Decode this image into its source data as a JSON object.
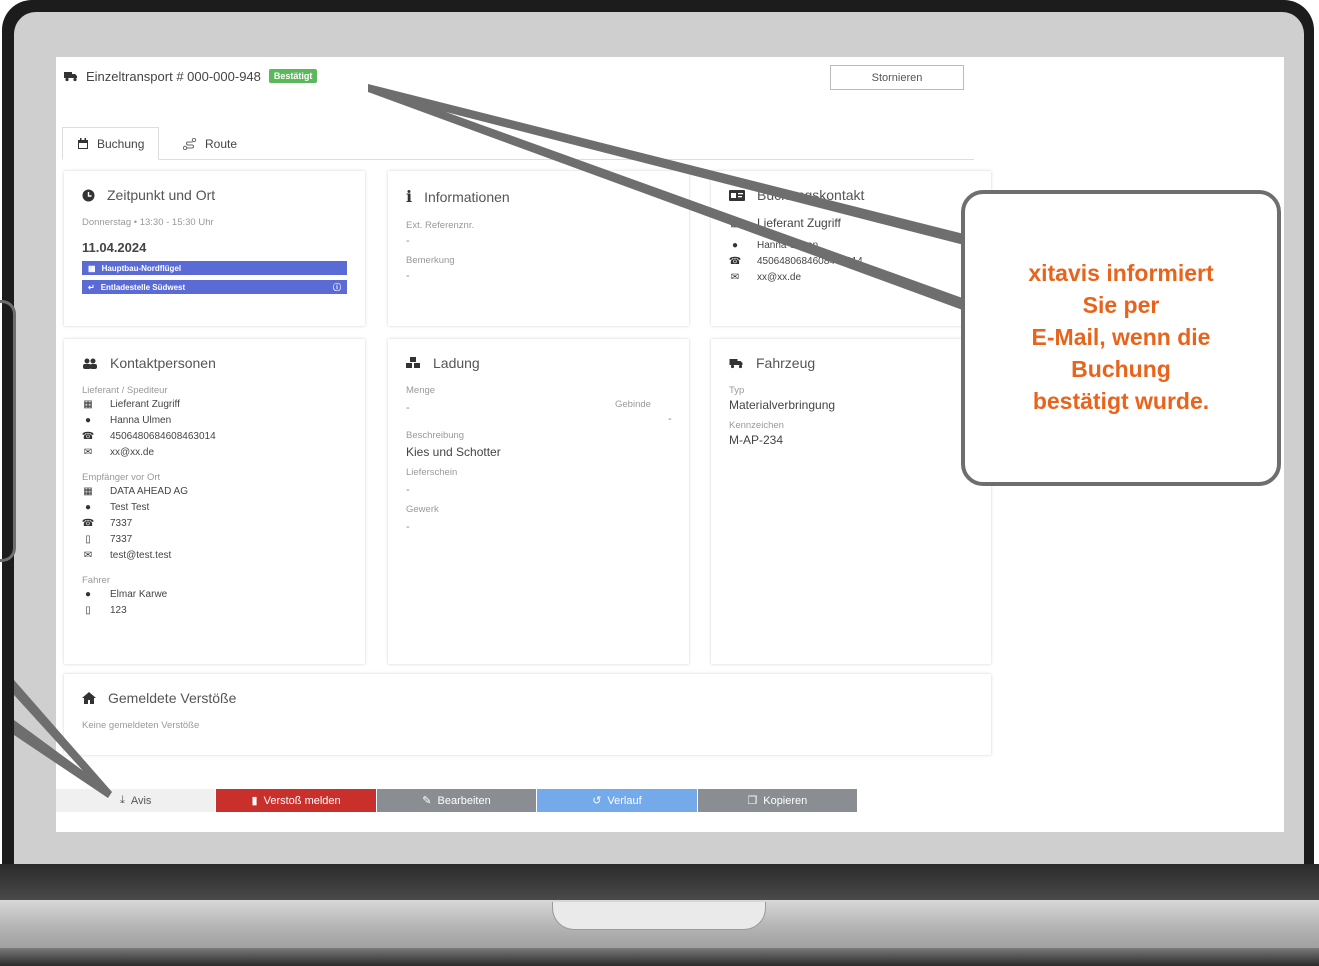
{
  "header": {
    "title": "Einzeltransport # 000-000-948",
    "status_badge": "Bestätigt",
    "cancel_label": "Stornieren"
  },
  "tabs": [
    {
      "label": "Buchung",
      "active": true
    },
    {
      "label": "Route",
      "active": false
    }
  ],
  "zeitpunkt": {
    "title": "Zeitpunkt und Ort",
    "time_text": "Donnerstag • 13:30 - 15:30 Uhr",
    "date": "11.04.2024",
    "locations": [
      "Hauptbau-Nordflügel",
      "Entladestelle Südwest"
    ]
  },
  "informationen": {
    "title": "Informationen",
    "ref_label": "Ext. Referenznr.",
    "ref_value": "-",
    "note_label": "Bemerkung",
    "note_value": "-"
  },
  "buchungskontakt": {
    "title": "Buchungskontakt",
    "company": "Lieferant Zugriff",
    "person": "Hanna Ulmen",
    "phone": "4506480684608463014",
    "email": "xx@xx.de"
  },
  "kontaktpersonen": {
    "title": "Kontaktpersonen",
    "lieferant_label": "Lieferant / Spediteur",
    "lieferant": {
      "company": "Lieferant Zugriff",
      "person": "Hanna Ulmen",
      "phone": "4506480684608463014",
      "email": "xx@xx.de"
    },
    "empfaenger_label": "Empfänger vor Ort",
    "empfaenger": {
      "company": "DATA AHEAD AG",
      "person": "Test Test",
      "phone": "7337",
      "mobile": "7337",
      "email": "test@test.test"
    },
    "fahrer_label": "Fahrer",
    "fahrer": {
      "person": "Elmar Karwe",
      "mobile": "123"
    }
  },
  "ladung": {
    "title": "Ladung",
    "menge_label": "Menge",
    "menge_value": "-",
    "gebinde_label": "Gebinde",
    "gebinde_value": "-",
    "beschreibung_label": "Beschreibung",
    "beschreibung_value": "Kies und Schotter",
    "lieferschein_label": "Lieferschein",
    "lieferschein_value": "-",
    "gewerk_label": "Gewerk",
    "gewerk_value": "-"
  },
  "fahrzeug": {
    "title": "Fahrzeug",
    "typ_label": "Typ",
    "typ_value": "Materialverbringung",
    "kennzeichen_label": "Kennzeichen",
    "kennzeichen_value": "M-AP-234"
  },
  "verstoesse": {
    "title": "Gemeldete Verstöße",
    "empty_text": "Keine gemeldeten Verstöße"
  },
  "actions": [
    {
      "label": "Avis",
      "icon": "download-icon",
      "color": "#f0f0f0",
      "text_color": "#555555"
    },
    {
      "label": "Verstoß melden",
      "icon": "file-icon",
      "color": "#c9302c",
      "text_color": "#ffffff"
    },
    {
      "label": "Bearbeiten",
      "icon": "edit-icon",
      "color": "#8a8e93",
      "text_color": "#ffffff"
    },
    {
      "label": "Verlauf",
      "icon": "history-icon",
      "color": "#74a9ea",
      "text_color": "#ffffff"
    },
    {
      "label": "Kopieren",
      "icon": "copy-icon",
      "color": "#8a8e93",
      "text_color": "#ffffff"
    }
  ],
  "callout": {
    "text": "xitavis informiert\nSie per\nE-Mail, wenn die\nBuchung\nbestätigt wurde.",
    "color": "#e8641c"
  }
}
